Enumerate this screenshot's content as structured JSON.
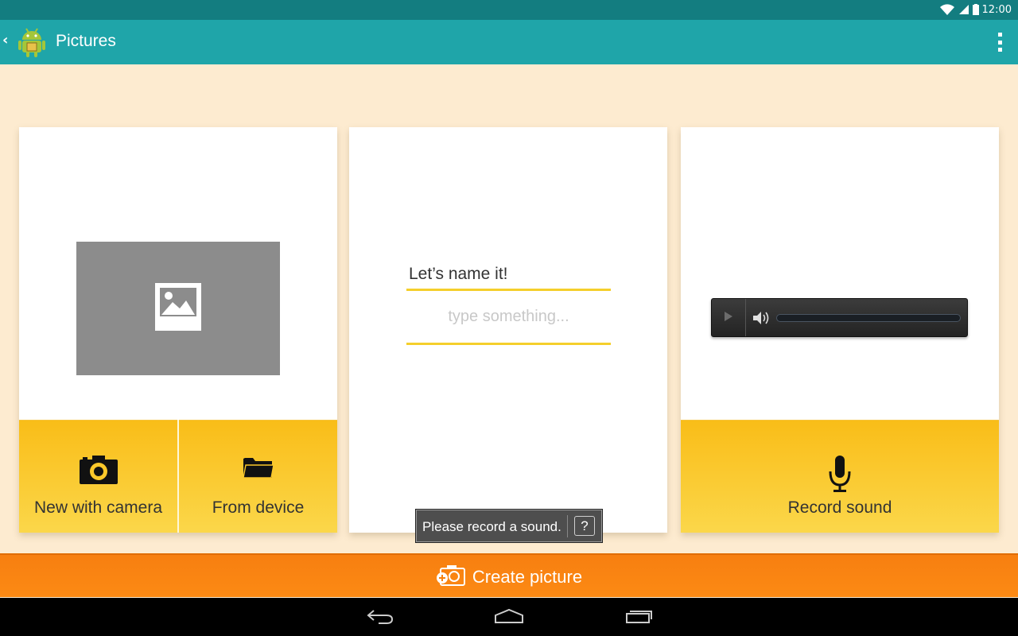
{
  "status_bar": {
    "time": "12:00",
    "icons": [
      "wifi-icon",
      "signal-icon",
      "battery-icon"
    ]
  },
  "action_bar": {
    "title": "Pictures",
    "icons": [
      "back-chevron-icon",
      "app-logo-icon",
      "overflow-menu-icon"
    ]
  },
  "image_card": {
    "placeholder_icon": "image-placeholder-icon",
    "buttons": [
      {
        "label": "New with camera",
        "icon": "camera-icon"
      },
      {
        "label": "From device",
        "icon": "folder-icon"
      }
    ]
  },
  "name_card": {
    "label": "Let’s name it!",
    "input_value": "",
    "input_placeholder": "type something..."
  },
  "sound_card": {
    "player_icons": [
      "play-icon",
      "volume-icon"
    ],
    "progress": 0,
    "button": {
      "label": "Record sound",
      "icon": "microphone-icon"
    }
  },
  "toast": {
    "text": "Please record a sound.",
    "help": "?"
  },
  "create_button": {
    "label": "Create picture",
    "icon": "create-picture-icon"
  },
  "nav_bar": {
    "icons": [
      "back-icon",
      "home-icon",
      "recent-apps-icon"
    ]
  },
  "colors": {
    "status_bar": "#137d80",
    "action_bar": "#1fa5a9",
    "background": "#fdebd0",
    "yellow_button": "#fbc82a",
    "underline": "#f5cf2c",
    "create_bar": "#f7820f"
  }
}
